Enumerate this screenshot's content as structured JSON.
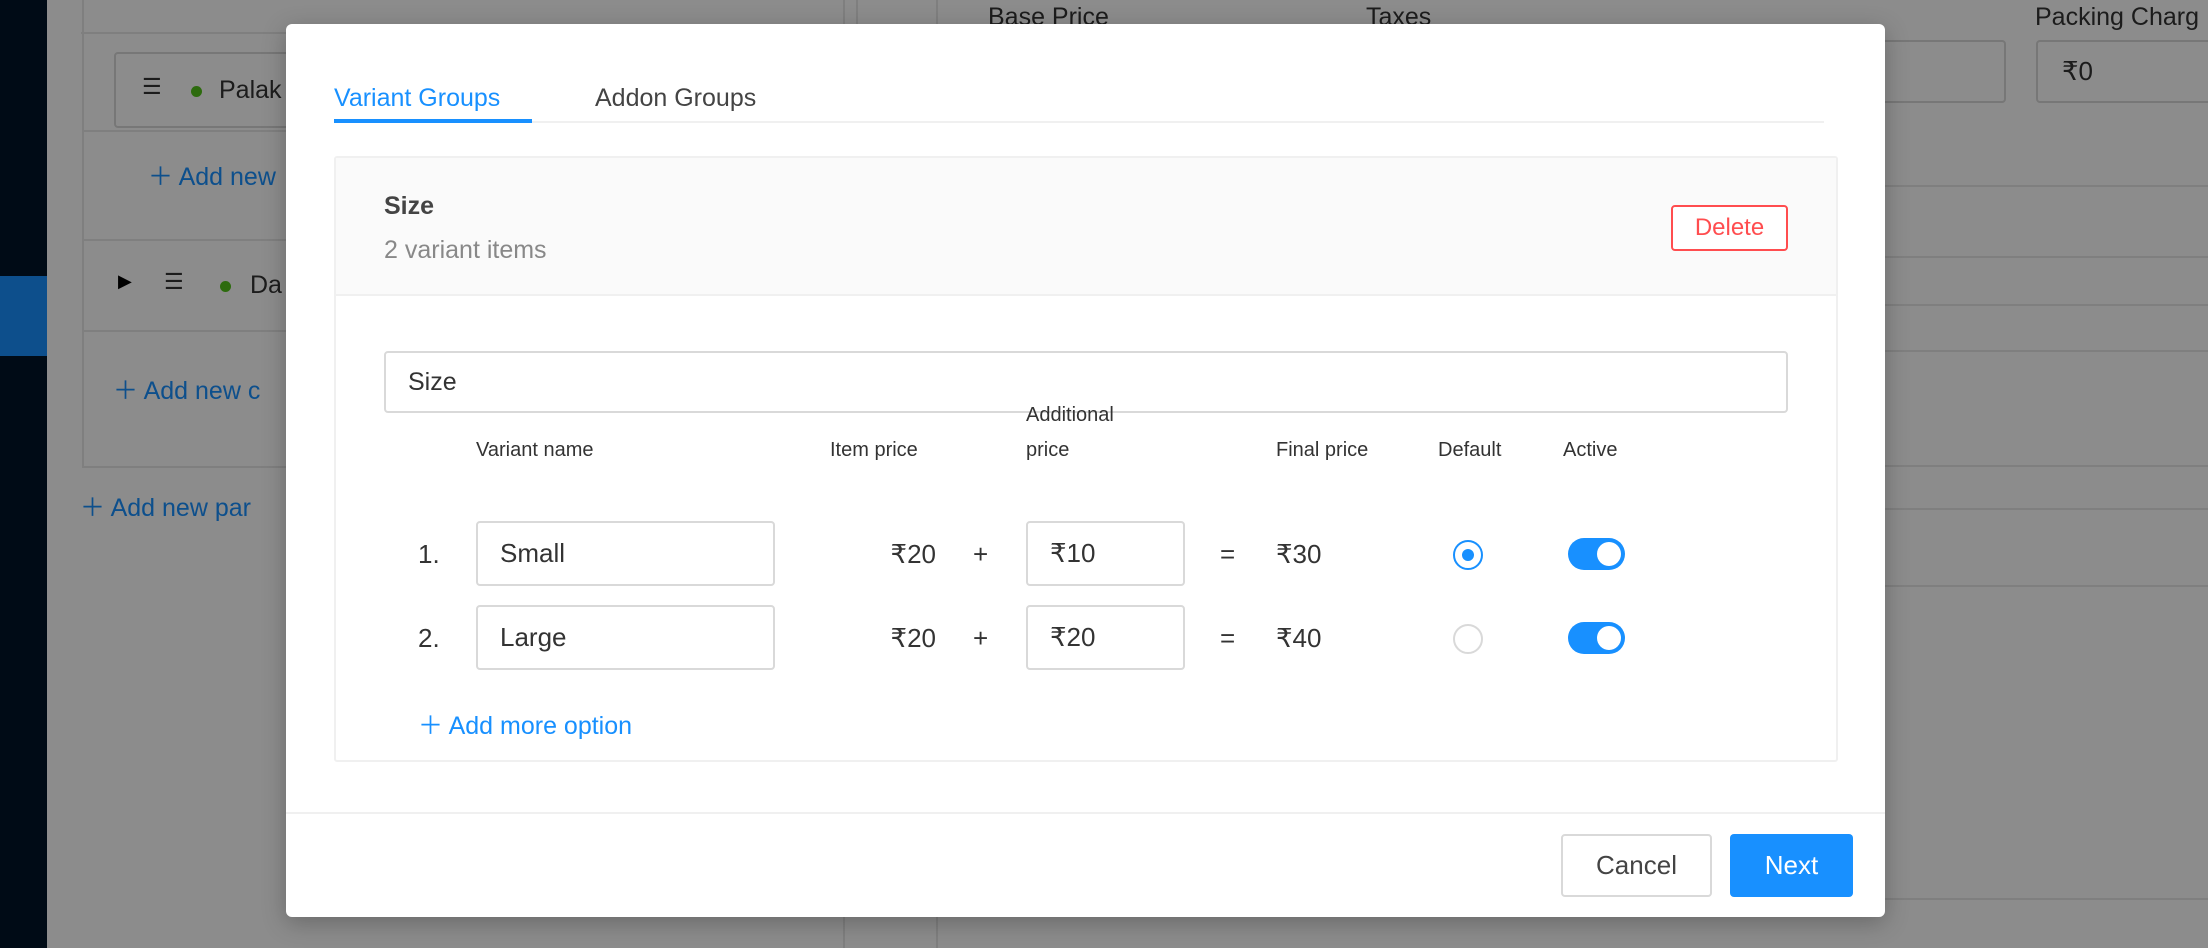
{
  "background": {
    "tree": {
      "item_palak": "Palak",
      "add_new_child": "Add new",
      "item_da": "Da",
      "add_new_category": "Add new c",
      "add_new_parent": "Add new par"
    },
    "form": {
      "base_price_label": "Base Price",
      "taxes_label": "Taxes",
      "packing_label": "Packing Charg",
      "packing_value": "₹0"
    }
  },
  "modal": {
    "tabs": [
      {
        "label": "Variant Groups",
        "active": true
      },
      {
        "label": "Addon Groups",
        "active": false
      }
    ],
    "group": {
      "title": "Size",
      "subtitle": "2 variant items",
      "delete_label": "Delete",
      "name_value": "Size",
      "headers": {
        "variant_name": "Variant name",
        "item_price": "Item price",
        "additional_price_1": "Additional",
        "additional_price_2": "price",
        "final_price": "Final price",
        "default": "Default",
        "active": "Active"
      },
      "rows": [
        {
          "index": "1.",
          "name": "Small",
          "item_price": "₹20",
          "plus": "+",
          "additional": "₹10",
          "equals": "=",
          "final": "₹30",
          "default": true,
          "active": true
        },
        {
          "index": "2.",
          "name": "Large",
          "item_price": "₹20",
          "plus": "+",
          "additional": "₹20",
          "equals": "=",
          "final": "₹40",
          "default": false,
          "active": true
        }
      ],
      "add_more_label": "Add more option"
    },
    "footer": {
      "cancel_label": "Cancel",
      "next_label": "Next"
    }
  },
  "colors": {
    "primary": "#1890ff",
    "danger": "#ff4d4f",
    "sidebar": "#001529",
    "status_dot": "#52c41a"
  }
}
